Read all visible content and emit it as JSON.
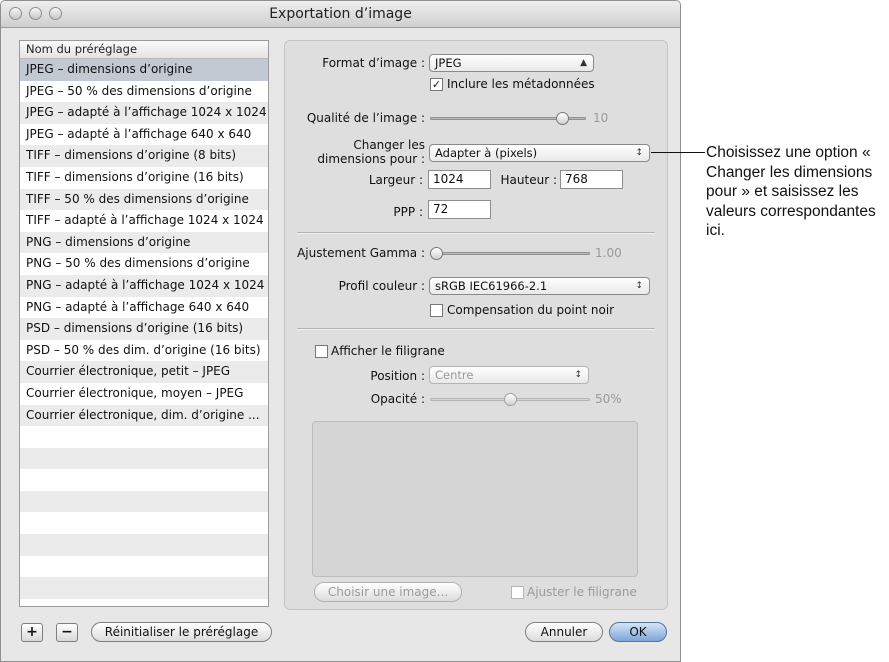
{
  "window": {
    "title": "Exportation d’image"
  },
  "presets": {
    "header": "Nom du préréglage",
    "items": [
      "JPEG – dimensions d’origine",
      "JPEG – 50 % des dimensions d’origine",
      "JPEG – adapté à l’affichage 1024 x 1024",
      "JPEG – adapté à l’affichage 640 x 640",
      "TIFF – dimensions d’origine (8 bits)",
      "TIFF – dimensions d’origine (16 bits)",
      "TIFF – 50 % des dimensions d’origine",
      "TIFF – adapté à l’affichage 1024 x 1024",
      "PNG – dimensions d’origine",
      "PNG – 50 % des dimensions d’origine",
      "PNG – adapté à l’affichage 1024 x 1024",
      "PNG – adapté à l’affichage 640 x 640",
      "PSD – dimensions d’origine (16 bits)",
      "PSD – 50 % des dim. d’origine (16 bits)",
      "Courrier électronique, petit – JPEG",
      "Courrier électronique, moyen – JPEG",
      "Courrier électronique, dim. d’origine ..."
    ],
    "selected_index": 0
  },
  "settings": {
    "format_label": "Format d’image :",
    "format_value": "JPEG",
    "include_metadata_label": "Inclure les métadonnées",
    "include_metadata_checked": true,
    "quality_label": "Qualité de l’image :",
    "quality_value": "10",
    "quality_fraction": 0.88,
    "resize_label_line1": "Changer les",
    "resize_label_line2": "dimensions pour :",
    "resize_value": "Adapter à (pixels)",
    "width_label": "Largeur :",
    "width_value": "1024",
    "height_label": "Hauteur :",
    "height_value": "768",
    "dpi_label": "PPP :",
    "dpi_value": "72",
    "gamma_label": "Ajustement Gamma :",
    "gamma_value": "1.00",
    "gamma_fraction": 0.0,
    "profile_label": "Profil couleur :",
    "profile_value": "sRGB IEC61966-2.1",
    "black_point_label": "Compensation du point noir",
    "black_point_checked": false,
    "watermark_label": "Afficher le filigrane",
    "watermark_checked": false,
    "position_label": "Position :",
    "position_value": "Centre",
    "opacity_label": "Opacité :",
    "opacity_value": "50%",
    "opacity_fraction": 0.5,
    "choose_image_label": "Choisir une image...",
    "fit_watermark_label": "Ajuster le filigrane"
  },
  "buttons": {
    "add": "+",
    "remove": "−",
    "reset": "Réinitialiser le préréglage",
    "cancel": "Annuler",
    "ok": "OK"
  },
  "callout": "Choisissez une option « Changer les dimensions pour » et saisissez les valeurs correspondantes ici."
}
